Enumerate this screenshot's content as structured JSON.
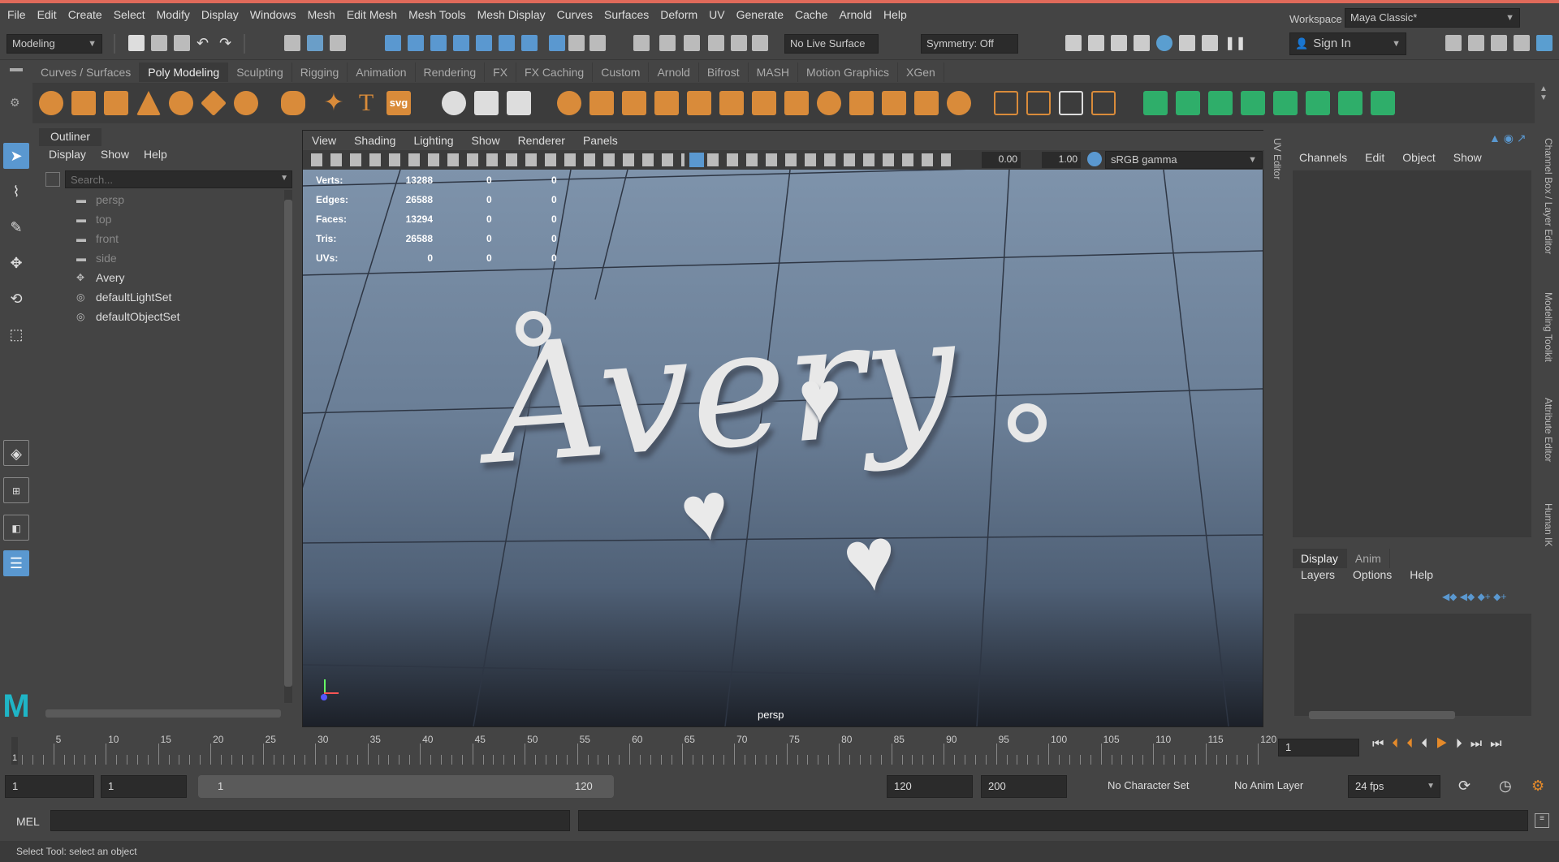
{
  "menubar": {
    "items": [
      "File",
      "Edit",
      "Create",
      "Select",
      "Modify",
      "Display",
      "Windows",
      "Mesh",
      "Edit Mesh",
      "Mesh Tools",
      "Mesh Display",
      "Curves",
      "Surfaces",
      "Deform",
      "UV",
      "Generate",
      "Cache",
      "Arnold",
      "Help"
    ],
    "workspace_label": "Workspace :",
    "workspace_value": "Maya Classic*"
  },
  "toolbar": {
    "mode": "Modeling",
    "live_surface": "No Live Surface",
    "symmetry": "Symmetry: Off",
    "sign_in": "Sign In"
  },
  "shelf": {
    "tabs": [
      "Curves / Surfaces",
      "Poly Modeling",
      "Sculpting",
      "Rigging",
      "Animation",
      "Rendering",
      "FX",
      "FX Caching",
      "Custom",
      "Arnold",
      "Bifrost",
      "MASH",
      "Motion Graphics",
      "XGen"
    ],
    "active": "Poly Modeling",
    "text_tool": "T",
    "svg_tool": "svg"
  },
  "outliner": {
    "title": "Outliner",
    "menus": [
      "Display",
      "Show",
      "Help"
    ],
    "search_placeholder": "Search...",
    "items": [
      {
        "label": "persp",
        "dim": true
      },
      {
        "label": "top",
        "dim": true
      },
      {
        "label": "front",
        "dim": true
      },
      {
        "label": "side",
        "dim": true
      },
      {
        "label": "Avery",
        "dim": false
      },
      {
        "label": "defaultLightSet",
        "dim": false
      },
      {
        "label": "defaultObjectSet",
        "dim": false
      }
    ]
  },
  "viewport": {
    "menus": [
      "View",
      "Shading",
      "Lighting",
      "Show",
      "Renderer",
      "Panels"
    ],
    "exposure": "0.00",
    "gamma": "1.00",
    "color_space": "sRGB gamma",
    "camera": "persp",
    "text3d": "Avery",
    "hud": [
      {
        "label": "Verts:",
        "a": "13288",
        "b": "0",
        "c": "0"
      },
      {
        "label": "Edges:",
        "a": "26588",
        "b": "0",
        "c": "0"
      },
      {
        "label": "Faces:",
        "a": "13294",
        "b": "0",
        "c": "0"
      },
      {
        "label": "Tris:",
        "a": "26588",
        "b": "0",
        "c": "0"
      },
      {
        "label": "UVs:",
        "a": "0",
        "b": "0",
        "c": "0"
      }
    ]
  },
  "right_panel": {
    "menus": [
      "Channels",
      "Edit",
      "Object",
      "Show"
    ],
    "layer_tabs": [
      "Display",
      "Anim"
    ],
    "layer_menus": [
      "Layers",
      "Options",
      "Help"
    ],
    "side_tabs": [
      "Channel Box / Layer Editor",
      "Modeling Toolkit",
      "Attribute Editor",
      "Human IK"
    ],
    "uv_editor": "UV Editor"
  },
  "timeline": {
    "ticks": [
      "5",
      "10",
      "15",
      "20",
      "25",
      "30",
      "35",
      "40",
      "45",
      "50",
      "55",
      "60",
      "65",
      "70",
      "75",
      "80",
      "85",
      "90",
      "95",
      "100",
      "105",
      "110",
      "115",
      "120"
    ],
    "current_start": "1",
    "current_frame": "1"
  },
  "range": {
    "start": "1",
    "start2": "1",
    "slider_start": "1",
    "slider_end": "120",
    "end": "120",
    "end2": "200",
    "character_set": "No Character Set",
    "anim_layer": "No Anim Layer",
    "fps": "24 fps"
  },
  "command": {
    "label": "MEL"
  },
  "help_line": "Select Tool: select an object"
}
